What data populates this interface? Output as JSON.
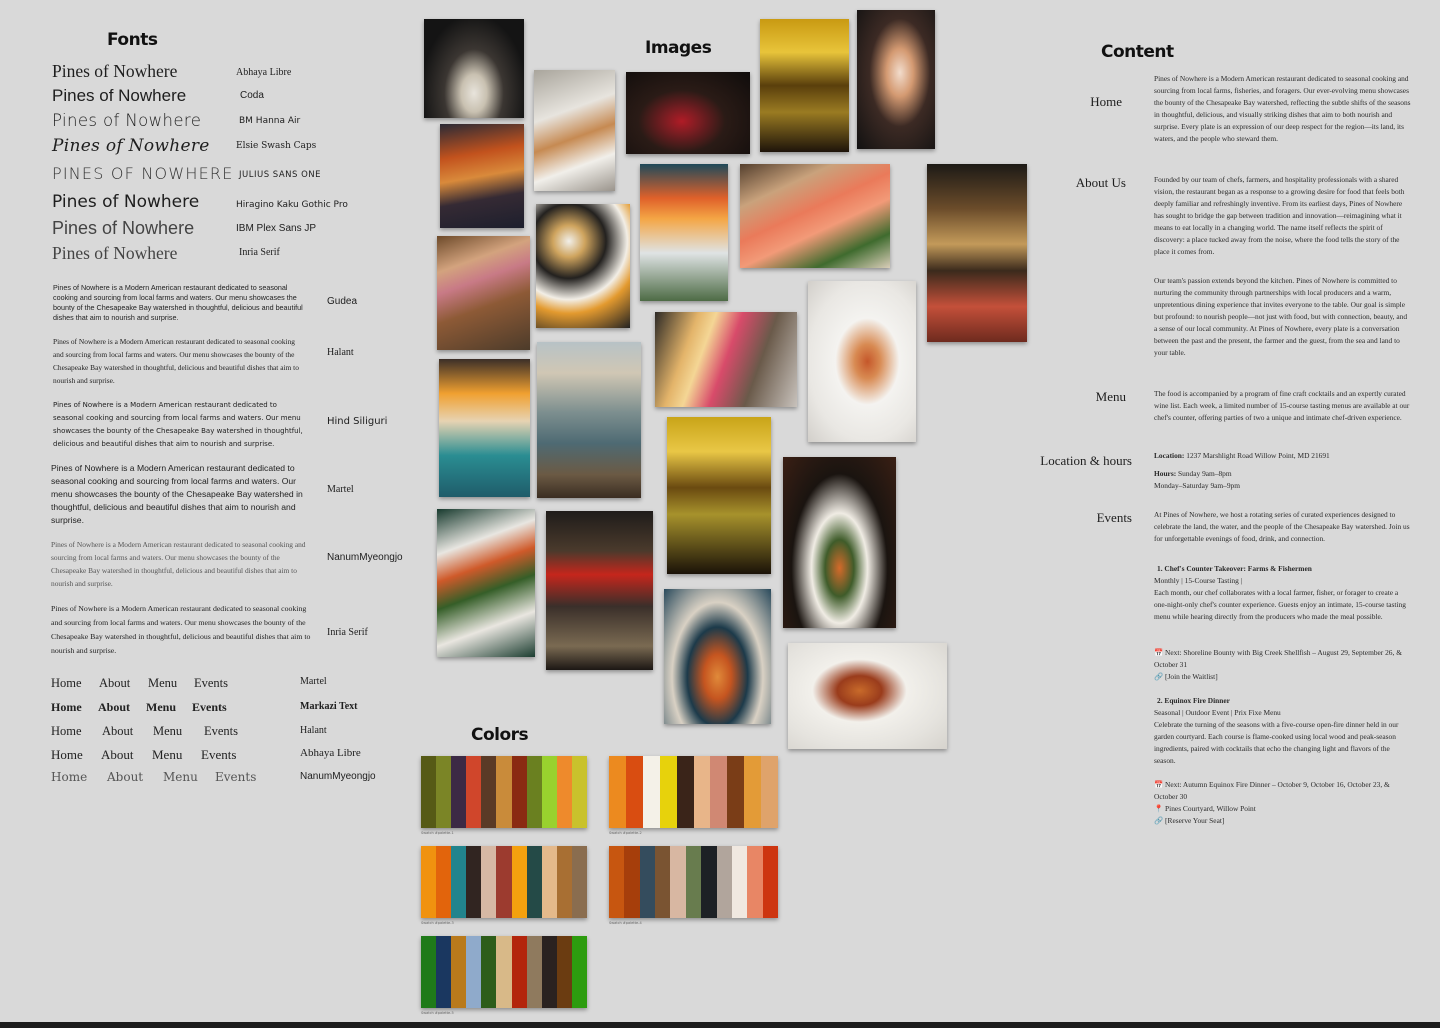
{
  "headings": {
    "fonts": "Fonts",
    "images": "Images",
    "colors": "Colors",
    "content": "Content"
  },
  "font_samples": [
    {
      "sample": "Pines of Nowhere",
      "font": "Abhaya Libre"
    },
    {
      "sample": "Pines of Nowhere",
      "font": "Coda"
    },
    {
      "sample": "Pines of Nowhere",
      "font": "BM Hanna Air"
    },
    {
      "sample": "Pines of Nowhere",
      "font": "Elsie Swash Caps"
    },
    {
      "sample": "Pines of Nowhere",
      "font": "Julius Sans One"
    },
    {
      "sample": "Pines of Nowhere",
      "font": "Hiragino Kaku Gothic Pro"
    },
    {
      "sample": "Pines of Nowhere",
      "font": "IBM Plex Sans JP"
    },
    {
      "sample": "Pines of Nowhere",
      "font": "Inria Serif"
    }
  ],
  "paragraph_samples": [
    {
      "text": "Pines of Nowhere is a Modern American restaurant dedicated to seasonal cooking and sourcing from local farms and waters. Our menu showcases the bounty of the Chesapeake Bay watershed in thoughtful, delicious and beautiful dishes that aim to nourish and surprise.",
      "font": "Gudea"
    },
    {
      "text": "Pines of Nowhere is a Modern American restaurant dedicated to seasonal cooking and sourcing from local farms and waters. Our menu showcases the bounty of the Chesapeake Bay watershed in thoughtful, delicious and beautiful dishes that aim to nourish and surprise.",
      "font": "Halant"
    },
    {
      "text": "Pines of Nowhere is a Modern American restaurant dedicated to seasonal cooking and sourcing from local farms and waters. Our menu showcases the bounty of the Chesapeake Bay watershed in thoughtful, delicious and beautiful dishes that aim to nourish and surprise.",
      "font": "Hind Siliguri"
    },
    {
      "text": "Pines of Nowhere is a Modern American restaurant dedicated to seasonal cooking and sourcing from local farms and waters. Our menu showcases the bounty of the Chesapeake Bay watershed in thoughtful, delicious and beautiful dishes that aim to nourish and surprise.",
      "font": "Martel"
    },
    {
      "text": "Pines of Nowhere is a Modern American restaurant dedicated to seasonal cooking and sourcing from local farms and waters. Our menu showcases the bounty of the Chesapeake Bay watershed in thoughtful, delicious and beautiful dishes that aim to nourish and surprise.",
      "font": "NanumMyeongjo"
    },
    {
      "text": "Pines of Nowhere is a Modern American restaurant dedicated to seasonal cooking and sourcing from local farms and waters. Our menu showcases the bounty of the Chesapeake Bay watershed in thoughtful, delicious and beautiful dishes that aim to nourish and surprise.",
      "font": "Inria Serif"
    }
  ],
  "nav_samples": [
    {
      "items": [
        "Home",
        "About",
        "Menu",
        "Events"
      ],
      "font": "Martel"
    },
    {
      "items": [
        "Home",
        "About",
        "Menu",
        "Events"
      ],
      "font": "Markazi Text"
    },
    {
      "items": [
        "Home",
        "About",
        "Menu",
        "Events"
      ],
      "font": "Halant"
    },
    {
      "items": [
        "Home",
        "About",
        "Menu",
        "Events"
      ],
      "font": "Abhaya Libre"
    },
    {
      "items": [
        "Home",
        "About",
        "Menu",
        "Events"
      ],
      "font": "NanumMyeongjo"
    }
  ],
  "palettes": [
    {
      "caption": "Swatch #palette-1",
      "colors": [
        "#565a16",
        "#7b8526",
        "#3c2a45",
        "#d0462b",
        "#5a3a26",
        "#c98b3a",
        "#8a2a12",
        "#6a8020",
        "#99d12e",
        "#ee8a2c",
        "#c9c22c"
      ]
    },
    {
      "caption": "Swatch #palette-2",
      "colors": [
        "#ec8a1f",
        "#d94d11",
        "#f4f1e8",
        "#e7d20c",
        "#3a2419",
        "#e8b589",
        "#d08873",
        "#7a3d17",
        "#e39b37",
        "#dfa36b"
      ]
    },
    {
      "caption": "Swatch #palette-3",
      "colors": [
        "#f0920f",
        "#e2640c",
        "#22848d",
        "#312521",
        "#d6b8a4",
        "#9c3b2f",
        "#f4a10f",
        "#244a47",
        "#e4b98b",
        "#a86f33",
        "#8a6d4f"
      ]
    },
    {
      "caption": "Swatch #palette-4",
      "colors": [
        "#c75610",
        "#a63e0b",
        "#344c5d",
        "#7a5432",
        "#d8b7a2",
        "#687c4e",
        "#1d2125",
        "#b1a59c",
        "#f0e8e0",
        "#e88665",
        "#cd3510"
      ]
    },
    {
      "caption": "Swatch #palette-5",
      "colors": [
        "#1f7a19",
        "#1a3760",
        "#b97a1c",
        "#8faacb",
        "#2d5d1a",
        "#d8b988",
        "#b3250c",
        "#8f7a5e",
        "#2a2220",
        "#6b3c11",
        "#2d9c0f"
      ]
    }
  ],
  "content": {
    "sections": [
      {
        "label": "Home",
        "paragraphs": [
          "Pines of Nowhere is a Modern American restaurant dedicated to seasonal cooking and sourcing from local farms, fisheries, and foragers. Our ever-evolving menu showcases the bounty of the Chesapeake Bay watershed, reflecting the subtle shifts of the seasons in thoughtful, delicious, and visually striking dishes that aim to both nourish and surprise. Every plate is an expression of our deep respect for the region—its land, its waters, and the people who steward them."
        ]
      },
      {
        "label": "About Us",
        "paragraphs": [
          "Founded by our team of chefs, farmers, and hospitality professionals with a shared vision, the restaurant began as a response to a growing desire for food that feels both deeply familiar and refreshingly inventive. From its earliest days, Pines of Nowhere has sought to bridge the gap between tradition and innovation—reimagining what it means to eat locally in a changing world. The name itself reflects the spirit of discovery: a place tucked away from the noise, where the food tells the story of the place it comes from.",
          "Our team's passion extends beyond the kitchen. Pines of Nowhere is committed to nurturing the community through partnerships with local producers and a warm, unpretentious dining experience that invites everyone to the table. Our goal is simple but profound: to nourish people—not just with food, but with connection, beauty, and a sense of our local community. At Pines of Nowhere, every plate is a conversation between the past and the present, the farmer and the guest, from the sea and land to your table."
        ]
      },
      {
        "label": "Menu",
        "paragraphs": [
          "The food is accompanied by a program of fine craft cocktails and an expertly curated wine list. Each week, a limited number of 15-course tasting menus are available at our chef's counter, offering parties of two a unique and intimate chef-driven experience."
        ]
      }
    ],
    "location": {
      "label": "Location & hours",
      "location_key": "Location:",
      "location_value": "1237 Marshlight Road Willow Point, MD 21691",
      "hours_key": "Hours:",
      "hours_1": "Sunday 9am–8pm",
      "hours_2": "Monday–Saturday 9am–9pm"
    },
    "events": {
      "label": "Events",
      "intro": "At Pines of Nowhere, we host a rotating series of curated experiences designed to celebrate the land, the water, and the people of the Chesapeake Bay watershed. Join us for unforgettable evenings of food, drink, and connection.",
      "items": [
        {
          "title": "1. Chef's Counter Takeover: Farms & Fishermen",
          "meta": "Monthly | 15-Course Tasting |",
          "desc": "Each month, our chef collaborates with a local farmer, fisher, or forager to create a one-night-only chef's counter experience. Guests enjoy an intimate, 15-course tasting menu while hearing directly from the producers who made the meal possible.",
          "next": "📅 Next: Shoreline Bounty with Big Creek Shellfish – August 29, September 26, & October 31",
          "place": "",
          "link": "🔗 [Join the Waitlist]"
        },
        {
          "title": "2. Equinox Fire Dinner",
          "meta": "Seasonal | Outdoor Event | Prix Fixe Menu",
          "desc": "Celebrate the turning of the seasons with a five-course open-fire dinner held in our garden courtyard. Each course is flame-cooked using local wood and peak-season ingredients, paired with cocktails that echo the changing light and flavors of the season.",
          "next": "📅 Next: Autumn Equinox Fire Dinner – October 9, October 16, October 23, & October 30",
          "place": "📍 Pines Courtyard, Willow Point",
          "link": "🔗 [Reserve Your Seat]"
        }
      ]
    }
  }
}
